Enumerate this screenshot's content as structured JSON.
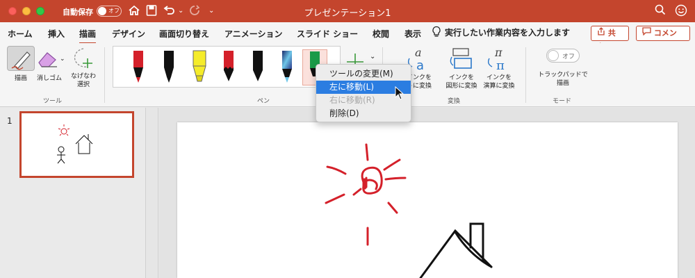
{
  "titlebar": {
    "autosave_label": "自動保存",
    "autosave_toggle": "オフ",
    "window_title": "プレゼンテーション1",
    "undo_icon": "undo-icon",
    "redo_icon": "redo-icon"
  },
  "tabs": [
    {
      "label": "ホーム"
    },
    {
      "label": "挿入"
    },
    {
      "label": "描画",
      "active": true
    },
    {
      "label": "デザイン"
    },
    {
      "label": "画面切り替え"
    },
    {
      "label": "アニメーション"
    },
    {
      "label": "スライド ショー"
    },
    {
      "label": "校閲"
    },
    {
      "label": "表示"
    }
  ],
  "tellme": "実行したい作業内容を入力します",
  "share_label": "共有",
  "comment_label": "コメント",
  "ribbon": {
    "tools": {
      "draw": "描画",
      "eraser": "消しゴム",
      "lasso_line1": "なげなわ",
      "lasso_line2": "選択",
      "group_label": "ツール"
    },
    "pens_group_label": "ペン",
    "convert": {
      "ink_to_text_line1": "インクを",
      "ink_to_text_line2": "トに変換",
      "ink_to_shape_line1": "インクを",
      "ink_to_shape_line2": "図形に変換",
      "ink_to_math_line1": "インクを",
      "ink_to_math_line2": "演算に変換",
      "group_label": "変換"
    },
    "mode": {
      "toggle": "オフ",
      "label_line1": "トラックパッドで",
      "label_line2": "描画",
      "group_label": "モード"
    }
  },
  "context_menu": {
    "items": [
      {
        "label": "ツールの変更(M)"
      },
      {
        "label": "左に移動(L)",
        "highlighted": true
      },
      {
        "label": "右に移動(R)",
        "disabled": true
      },
      {
        "label": "削除(D)"
      }
    ]
  },
  "slides_panel": {
    "slide_number": "1"
  },
  "colors": {
    "accent": "#c4452d",
    "highlight": "#2b7de1"
  }
}
